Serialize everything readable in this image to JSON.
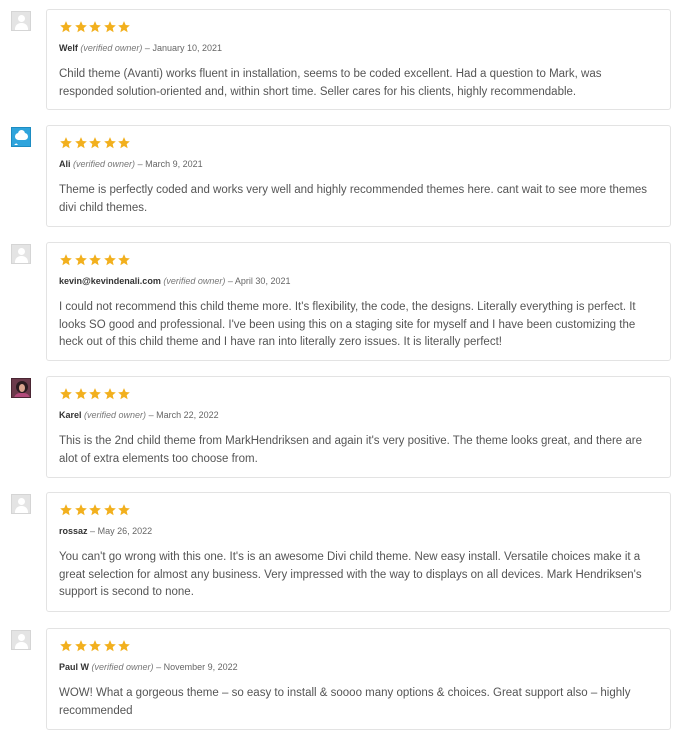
{
  "reviews": [
    {
      "avatar": "placeholder-avatar",
      "rating": 5,
      "author": "Welf",
      "verified": "(verified owner)",
      "separator": "–",
      "date": "January 10, 2021",
      "text": "Child theme (Avanti) works fluent in installation, seems to be coded excellent. Had a question to Mark, was responded solution-oriented and, within short time. Seller cares for his clients, highly recommendable."
    },
    {
      "avatar": "cloud-avatar",
      "rating": 5,
      "author": "Ali",
      "verified": "(verified owner)",
      "separator": "–",
      "date": "March 9, 2021",
      "text": "Theme is perfectly coded and works very well and highly recommended themes here. cant wait to see more themes divi child themes."
    },
    {
      "avatar": "placeholder-avatar",
      "rating": 5,
      "author": "kevin@kevindenali.com",
      "verified": "(verified owner)",
      "separator": "–",
      "date": "April 30, 2021",
      "text": "I could not recommend this child theme more. It's flexibility, the code, the designs. Literally everything is perfect. It looks SO good and professional. I've been using this on a staging site for myself and I have been customizing the heck out of this child theme and I have ran into literally zero issues. It is literally perfect!"
    },
    {
      "avatar": "photo-avatar",
      "rating": 5,
      "author": "Karel",
      "verified": "(verified owner)",
      "separator": "–",
      "date": "March 22, 2022",
      "text": "This is the 2nd child theme from MarkHendriksen and again it's very positive. The theme looks great, and there are alot of extra elements too choose from."
    },
    {
      "avatar": "placeholder-avatar",
      "rating": 5,
      "author": "rossaz",
      "verified": "",
      "separator": "–",
      "date": "May 26, 2022",
      "text": "You can't go wrong with this one. It's is an awesome Divi child theme. New easy install. Versatile choices make it a great selection for almost any business. Very impressed with the way to displays on all devices. Mark Hendriksen's support is second to none."
    },
    {
      "avatar": "placeholder-avatar",
      "rating": 5,
      "author": "Paul W",
      "verified": "(verified owner)",
      "separator": "–",
      "date": "November 9, 2022",
      "text": "WOW! What a gorgeous theme – so easy to install & soooo many options & choices. Great support also – highly recommended"
    }
  ],
  "colors": {
    "star": "#f2b01e",
    "border": "#e3e3e3",
    "text": "#555555"
  }
}
